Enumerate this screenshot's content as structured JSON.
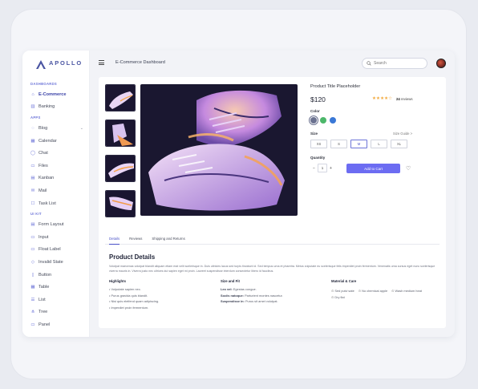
{
  "brand": {
    "name": "APOLLO",
    "accent": "#6c6cf2"
  },
  "sidebar": {
    "sections": [
      {
        "title": "DASHBOARDS",
        "items": [
          {
            "label": "E-Commerce",
            "icon": "home-icon",
            "active": true
          },
          {
            "label": "Banking",
            "icon": "bank-icon"
          }
        ]
      },
      {
        "title": "APPS",
        "items": [
          {
            "label": "Blog",
            "icon": "chat-bubble-icon",
            "chevron": "⌄"
          },
          {
            "label": "Calendar",
            "icon": "calendar-icon"
          },
          {
            "label": "Chat",
            "icon": "chat-icon"
          },
          {
            "label": "Files",
            "icon": "folder-icon"
          },
          {
            "label": "Kanban",
            "icon": "kanban-icon"
          },
          {
            "label": "Mail",
            "icon": "mail-icon"
          },
          {
            "label": "Task List",
            "icon": "checkbox-icon"
          }
        ]
      },
      {
        "title": "UI KIT",
        "items": [
          {
            "label": "Form Layout",
            "icon": "layout-icon"
          },
          {
            "label": "Input",
            "icon": "input-icon"
          },
          {
            "label": "Float Label",
            "icon": "float-label-icon"
          },
          {
            "label": "Invalid State",
            "icon": "alert-icon"
          },
          {
            "label": "Button",
            "icon": "button-icon"
          },
          {
            "label": "Table",
            "icon": "table-icon"
          },
          {
            "label": "List",
            "icon": "list-icon"
          },
          {
            "label": "Tree",
            "icon": "tree-icon"
          },
          {
            "label": "Panel",
            "icon": "panel-icon"
          }
        ]
      }
    ]
  },
  "topbar": {
    "title": "E-Commerce Dashboard",
    "search_placeholder": "Search"
  },
  "product": {
    "title": "Product Title Placeholder",
    "price": "$120",
    "stars": "★★★★☆",
    "rating_fraction": 0.8,
    "reviews_count": "24",
    "reviews_label": "reviews",
    "color_label": "Color",
    "colors": [
      "#6b7290",
      "#4cb76a",
      "#3a78d6"
    ],
    "size_label": "Size",
    "size_guide": "Size Guide >",
    "sizes": [
      "XS",
      "S",
      "M",
      "L",
      "XL"
    ],
    "selected_size": "M",
    "quantity_label": "Quantity",
    "quantity_minus": "−",
    "quantity": "1",
    "quantity_plus": "+",
    "add_to_cart": "Add to Cart",
    "heart": "♡"
  },
  "tabs": [
    "Details",
    "Reviews",
    "Shipping and Returns"
  ],
  "details": {
    "title": "Product Details",
    "description": "Volutpat maecenas volutpat blandit aliquam etiam erat velit scelerisque in. Duis ultricies lacus sed turpis tincidunt id. Sed tempus urna et pharetra. Metus vulputate eu scelerisque felis imperdiet proin fermentum. Venenatis urna cursus eget nunc scelerisque viverra mauris in. Viverra justo nec ultrices dui sapien eget mi proin. Laoreet suspendisse interdum consectetur libero id faucibus.",
    "highlights": {
      "title": "Highlights",
      "items": [
        "• Vulputate sapien nec.",
        "• Purus gravida quis blandit.",
        "• Nisi quis eleifend quam adipiscing.",
        "• Imperdiet proin fermentum."
      ]
    },
    "size_fit": {
      "title": "Size and Fit",
      "rows": [
        {
          "key": "Leo vel:",
          "value": "Egestas congue."
        },
        {
          "key": "Sociis natoque:",
          "value": "Parturient montes nascetur."
        },
        {
          "key": "Suspendisse in:",
          "value": "Purus sit amet volutpat."
        }
      ]
    },
    "material": {
      "title": "Material & Care",
      "items": [
        "Sed pulvi sate",
        "No chemical apple",
        "Wash medium heat",
        "Dry flat"
      ]
    }
  }
}
